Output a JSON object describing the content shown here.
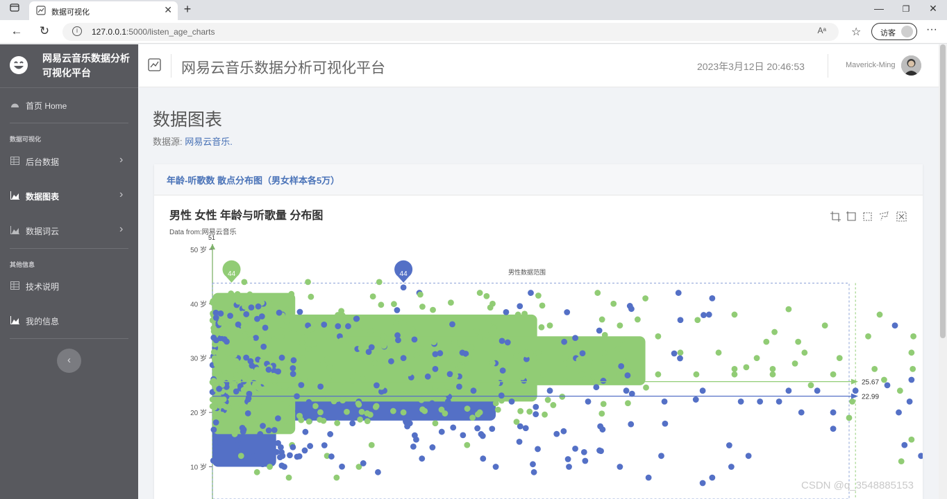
{
  "browser": {
    "tab_title": "数据可视化",
    "url_host": "127.0.0.1",
    "url_path": ":5000/listen_age_charts",
    "read_aloud": "Aᵃ",
    "guest_label": "访客"
  },
  "sidebar": {
    "brand_title": "网易云音乐数据分析可视化平台",
    "home_label": "首页 Home",
    "section_viz": "数据可视化",
    "items": [
      {
        "label": "后台数据",
        "icon": "table-icon"
      },
      {
        "label": "数据图表",
        "icon": "area-chart-icon"
      },
      {
        "label": "数据词云",
        "icon": "area-chart-icon"
      }
    ],
    "section_other": "其他信息",
    "other_items": [
      {
        "label": "技术说明",
        "icon": "table-icon"
      },
      {
        "label": "我的信息",
        "icon": "area-chart-icon"
      }
    ]
  },
  "header": {
    "title": "网易云音乐数据分析可视化平台",
    "datetime": "2023年3月12日 20:46:53",
    "username": "Maverick-Ming"
  },
  "page": {
    "title": "数据图表",
    "source_prefix": "数据源: ",
    "source_link": "网易云音乐."
  },
  "card": {
    "title": "年龄-听歌数 散点分布图（男女样本各5万）"
  },
  "chart_data": {
    "type": "scatter",
    "title": "男性 女性 年龄与听歌量 分布图",
    "subtitle": "Data from:网易云音乐",
    "y_axis_name": "51",
    "y_ticks": [
      "50 岁",
      "40 岁",
      "30 岁",
      "20 岁",
      "10 岁"
    ],
    "ylim": [
      7,
      51
    ],
    "xlim": [
      0,
      1000
    ],
    "colors": {
      "male": "#5470c6",
      "female": "#91cc75"
    },
    "mark_points": [
      {
        "series": "female",
        "label": "44",
        "x": 30,
        "y": 44
      },
      {
        "series": "male",
        "label": "44",
        "x": 300,
        "y": 44
      }
    ],
    "mark_lines": [
      {
        "series": "female",
        "label": "25.67",
        "y": 25.67
      },
      {
        "series": "male",
        "label": "22.99",
        "y": 22.99
      }
    ],
    "mark_area_label": "男性数据范围",
    "series": [
      {
        "key": "female",
        "points": [
          [
            50,
            44
          ],
          [
            150,
            44
          ],
          [
            262,
            44
          ],
          [
            420,
            42
          ],
          [
            605,
            42
          ],
          [
            630,
            40
          ],
          [
            820,
            38
          ],
          [
            762,
            37
          ],
          [
            905,
            39
          ],
          [
            1048,
            38
          ],
          [
            920,
            33
          ],
          [
            962,
            36
          ],
          [
            1030,
            34
          ],
          [
            1098,
            31
          ],
          [
            1130,
            31
          ],
          [
            1178,
            30
          ],
          [
            1232,
            30
          ],
          [
            1055,
            26
          ],
          [
            1080,
            24
          ],
          [
            1178,
            26
          ],
          [
            1082,
            11
          ],
          [
            1098,
            15
          ],
          [
            1000,
            19
          ],
          [
            1005,
            22
          ],
          [
            1101,
            34
          ],
          [
            1180,
            22
          ],
          [
            880,
            28
          ],
          [
            820,
            28
          ],
          [
            700,
            34
          ],
          [
            640,
            36
          ],
          [
            580,
            30
          ],
          [
            530,
            36
          ],
          [
            480,
            38
          ],
          [
            440,
            40
          ],
          [
            420,
            20
          ],
          [
            400,
            14
          ],
          [
            350,
            18
          ],
          [
            300,
            20
          ],
          [
            250,
            14
          ],
          [
            230,
            10
          ],
          [
            195,
            8
          ],
          [
            180,
            12
          ],
          [
            125,
            14
          ],
          [
            120,
            8
          ],
          [
            90,
            10
          ],
          [
            70,
            9
          ],
          [
            45,
            12
          ],
          [
            35,
            16
          ],
          [
            50,
            20
          ],
          [
            60,
            24
          ],
          [
            400,
            27
          ],
          [
            460,
            27
          ],
          [
            520,
            27
          ],
          [
            580,
            27
          ],
          [
            640,
            27
          ],
          [
            700,
            27
          ],
          [
            760,
            27
          ],
          [
            820,
            27
          ],
          [
            880,
            27
          ],
          [
            940,
            25
          ],
          [
            350,
            30
          ],
          [
            380,
            33
          ],
          [
            415,
            35
          ],
          [
            445,
            32
          ],
          [
            495,
            31
          ],
          [
            555,
            29
          ],
          [
            615,
            31
          ],
          [
            675,
            29
          ],
          [
            735,
            31
          ],
          [
            795,
            31
          ],
          [
            855,
            30
          ],
          [
            915,
            29
          ],
          [
            975,
            27
          ],
          [
            1100,
            28
          ],
          [
            1040,
            28
          ],
          [
            985,
            30
          ],
          [
            930,
            31
          ],
          [
            870,
            33
          ]
        ]
      },
      {
        "key": "male",
        "points": [
          [
            300,
            43
          ],
          [
            325,
            42
          ],
          [
            500,
            42
          ],
          [
            732,
            42
          ],
          [
            785,
            41
          ],
          [
            780,
            38
          ],
          [
            735,
            37
          ],
          [
            1072,
            36
          ],
          [
            1175,
            33
          ],
          [
            1222,
            30
          ],
          [
            1162,
            30
          ],
          [
            1145,
            30
          ],
          [
            1098,
            26
          ],
          [
            1142,
            24
          ],
          [
            1095,
            22
          ],
          [
            1078,
            20
          ],
          [
            1060,
            25
          ],
          [
            975,
            20
          ],
          [
            975,
            17
          ],
          [
            925,
            20
          ],
          [
            905,
            24
          ],
          [
            860,
            22
          ],
          [
            842,
            12
          ],
          [
            815,
            10
          ],
          [
            785,
            8
          ],
          [
            770,
            7
          ],
          [
            705,
            12
          ],
          [
            685,
            8
          ],
          [
            640,
            10
          ],
          [
            608,
            13
          ],
          [
            560,
            10
          ],
          [
            505,
            9
          ],
          [
            445,
            10
          ],
          [
            422,
            16
          ],
          [
            400,
            20
          ],
          [
            370,
            22
          ],
          [
            330,
            20
          ],
          [
            310,
            18
          ],
          [
            270,
            24
          ],
          [
            230,
            22
          ],
          [
            220,
            18
          ],
          [
            185,
            16
          ],
          [
            145,
            13
          ],
          [
            110,
            12
          ],
          [
            75,
            16
          ],
          [
            55,
            22
          ],
          [
            40,
            30
          ],
          [
            45,
            36
          ],
          [
            80,
            40
          ],
          [
            110,
            38
          ],
          [
            150,
            36
          ],
          [
            200,
            34
          ],
          [
            250,
            32
          ],
          [
            300,
            30
          ],
          [
            350,
            28
          ],
          [
            410,
            24
          ],
          [
            470,
            22
          ],
          [
            530,
            24
          ],
          [
            590,
            22
          ],
          [
            650,
            24
          ],
          [
            710,
            22
          ],
          [
            770,
            24
          ],
          [
            830,
            22
          ],
          [
            890,
            22
          ],
          [
            950,
            24
          ],
          [
            1010,
            24
          ],
          [
            1113,
            12
          ],
          [
            1087,
            14
          ],
          [
            1160,
            8
          ],
          [
            1205,
            25
          ],
          [
            320,
            15
          ],
          [
            260,
            9
          ]
        ]
      }
    ]
  }
}
